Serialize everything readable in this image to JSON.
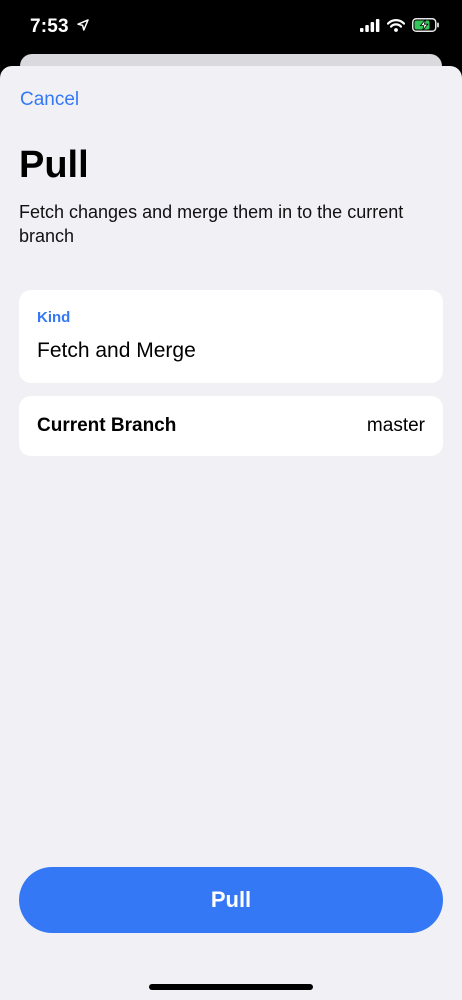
{
  "status_bar": {
    "time": "7:53",
    "icons": [
      "location-arrow-icon",
      "cellular-signal-icon",
      "wifi-icon",
      "battery-charging-icon"
    ]
  },
  "nav": {
    "cancel_label": "Cancel"
  },
  "header": {
    "title": "Pull",
    "subtitle": "Fetch changes and merge them in to the current branch"
  },
  "form": {
    "kind": {
      "label": "Kind",
      "value": "Fetch and Merge"
    },
    "current_branch": {
      "label": "Current Branch",
      "value": "master"
    }
  },
  "actions": {
    "pull_label": "Pull"
  },
  "colors": {
    "accent": "#3478f6",
    "sheet_background": "#f0f0f5",
    "card_background": "#ffffff",
    "battery_charging": "#34c759"
  }
}
